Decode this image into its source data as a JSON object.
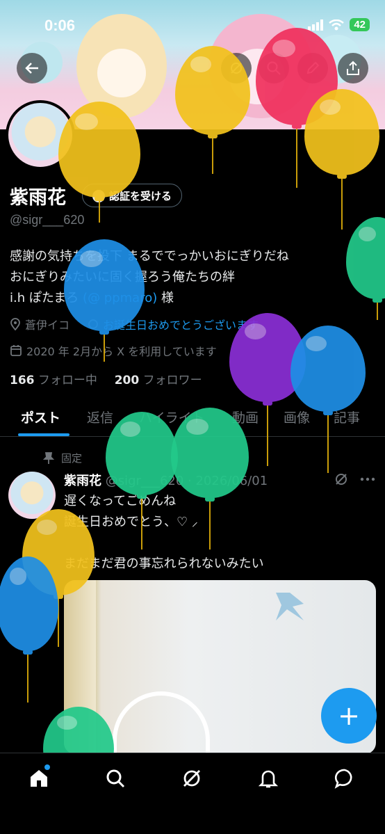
{
  "status_bar": {
    "time": "0:06",
    "battery": "42"
  },
  "profile": {
    "name": "紫雨花",
    "verify_label": "認証を受ける",
    "handle": "@sigr___620",
    "bio_lines": [
      "感謝の気持ちを投下 まるででっかいおにぎりだね",
      "おにぎりみたいに固く握ろう俺たちの絆",
      "i.h ぽたまろ "
    ],
    "bio_mention": "(@ ppmaro)",
    "bio_suffix": " 様",
    "location": "蒼伊イコ",
    "link_text": "お誕生日おめでとうございます",
    "joined": "2020 年 2月から X を利用しています",
    "following_count": "166",
    "following_label": "フォロー中",
    "followers_count": "200",
    "followers_label": "フォロワー"
  },
  "tabs": [
    "ポスト",
    "返信",
    "ハイライト",
    "動画",
    "画像",
    "記事"
  ],
  "post": {
    "pinned_label": "固定",
    "author": "紫雨花",
    "meta": "@sigr___620 · 2026/06/01",
    "lines": [
      "遅くなってごめんね",
      "誕生日おめでとう、♡ ⸝",
      "",
      "まだまだ君の事忘れられないみたい"
    ]
  },
  "fab_label": "+",
  "colors": {
    "accent": "#1d9bf0",
    "balloon_yellow": "#f2c21d",
    "balloon_red": "#f0315e",
    "balloon_green": "#22c98a",
    "balloon_blue": "#1f8fe6",
    "balloon_purple": "#8a2fd6"
  },
  "icons": {
    "back": "arrow-left-icon",
    "grok": "grok-icon",
    "search": "search-icon",
    "edit": "pencil-icon",
    "share": "share-icon",
    "location": "location-pin-icon",
    "calendar": "calendar-icon",
    "nav": [
      "home-icon",
      "search-icon",
      "grok-icon",
      "bell-icon",
      "messages-icon"
    ]
  }
}
